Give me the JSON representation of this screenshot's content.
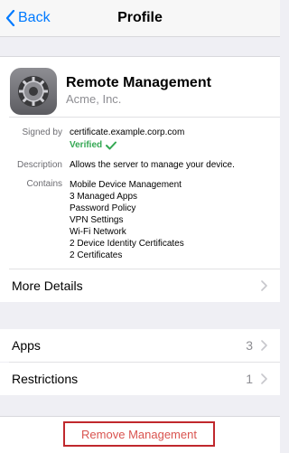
{
  "nav": {
    "back_label": "Back",
    "title": "Profile"
  },
  "profile": {
    "name": "Remote Management",
    "organization": "Acme, Inc.",
    "signed_by_label": "Signed by",
    "signed_by_value": "certificate.example.corp.com",
    "verified_label": "Verified",
    "description_label": "Description",
    "description_value": "Allows the server to manage your device.",
    "contains_label": "Contains",
    "contains_items": [
      "Mobile Device Management",
      "3 Managed Apps",
      "Password Policy",
      "VPN Settings",
      "Wi-Fi Network",
      "2 Device Identity Certificates",
      "2 Certificates"
    ]
  },
  "rows": {
    "more_details": "More Details",
    "apps_label": "Apps",
    "apps_count": "3",
    "restrictions_label": "Restrictions",
    "restrictions_count": "1"
  },
  "actions": {
    "remove_label": "Remove Management"
  },
  "colors": {
    "accent": "#007aff",
    "verified": "#34a853",
    "destructive": "#d9534f",
    "highlight_border": "#c0282d"
  }
}
